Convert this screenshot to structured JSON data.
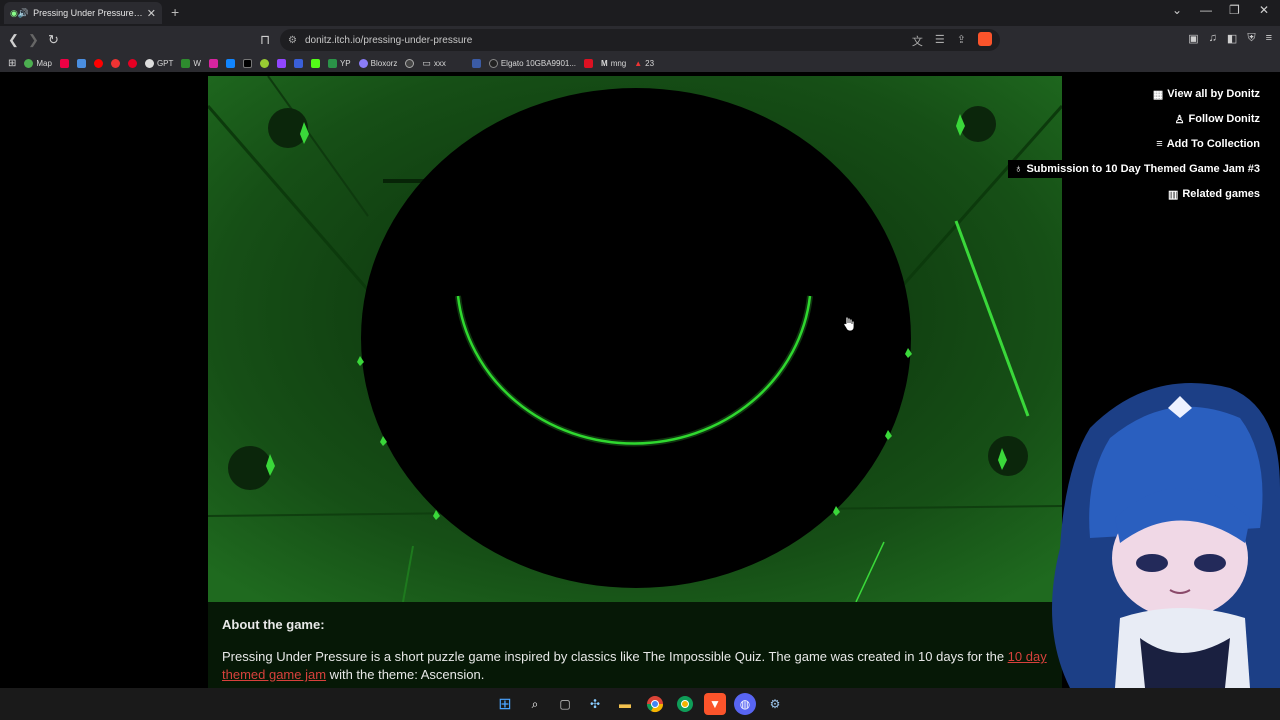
{
  "browser": {
    "tab_title": "Pressing Under Pressure by Donitz",
    "url": "donitz.itch.io/pressing-under-pressure",
    "bookmarks": [
      "Map",
      "GPT",
      "W",
      "YP",
      "Bloxorz",
      "xxx",
      "Elgato 10GBA9901...",
      "mng",
      "23"
    ]
  },
  "sidebar": {
    "view_all": "View all by Donitz",
    "follow": "Follow Donitz",
    "add_collection": "Add To Collection",
    "submission": "Submission to 10 Day Themed Game Jam #3",
    "related": "Related games"
  },
  "about": {
    "heading": "About the game:",
    "text_before": "Pressing Under Pressure is a short puzzle game inspired by classics like The Impossible Quiz. The game was created in 10 days for the ",
    "link": "10 day themed game jam",
    "text_after": " with the theme: Ascension."
  },
  "colors": {
    "game_green": "#1a5a1a",
    "accent_green": "#3ad83a",
    "link_red": "#d7413c"
  }
}
